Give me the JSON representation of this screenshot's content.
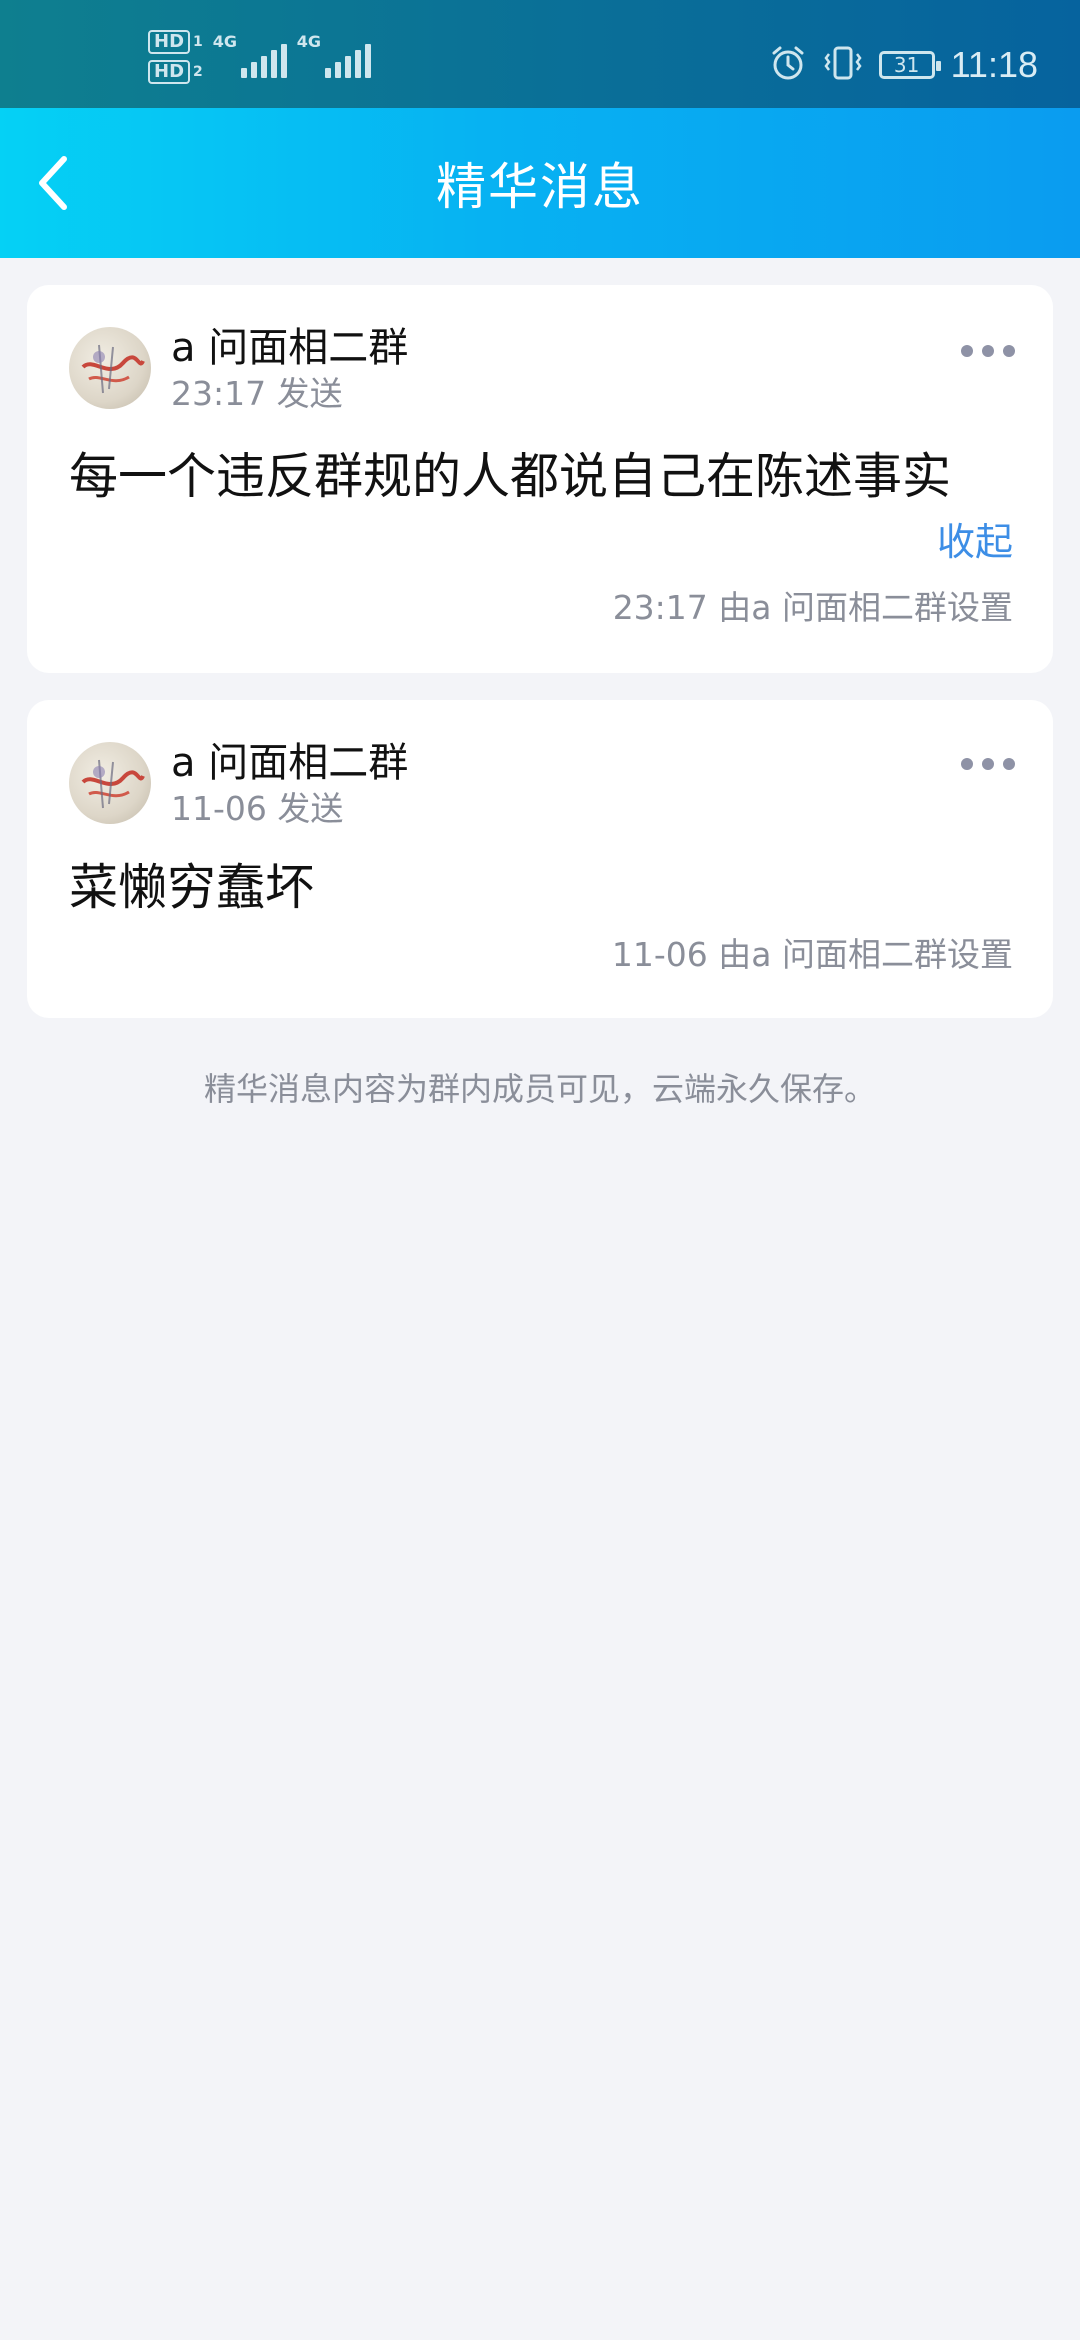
{
  "status_bar": {
    "hd1": "HD",
    "hd1_sub": "1",
    "hd2": "HD",
    "hd2_sub": "2",
    "net1": "4G",
    "net2": "4G",
    "battery": "31",
    "time": "11:18",
    "icons": [
      "alarm-icon",
      "vibrate-icon",
      "battery-icon"
    ]
  },
  "header": {
    "title": "精华消息",
    "back_icon": "chevron-left-icon"
  },
  "messages": [
    {
      "sender": "a 问面相二群",
      "sent_time": "23:17 发送",
      "text": "每一个违反群规的人都说自己在陈述事实",
      "collapse_label": "收起",
      "set_by": "23:17 由a 问面相二群设置"
    },
    {
      "sender": "a 问面相二群",
      "sent_time": "11-06 发送",
      "text": "菜懒穷蠢坏",
      "set_by": "11-06 由a 问面相二群设置"
    }
  ],
  "footer_note": "精华消息内容为群内成员可见，云端永久保存。",
  "colors": {
    "header_gradient_start": "#05d1f5",
    "header_gradient_end": "#0a9cf0",
    "accent_link": "#3d8ee6",
    "background": "#f3f4f8"
  }
}
